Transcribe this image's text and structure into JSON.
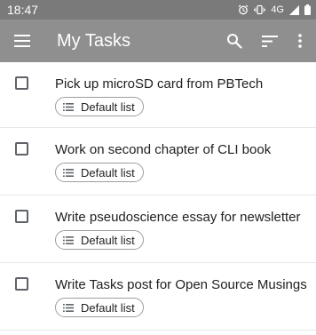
{
  "status_bar": {
    "time": "18:47",
    "network": "4G",
    "icons": [
      "alarm-icon",
      "vibrate-icon",
      "signal-icon",
      "battery-icon"
    ]
  },
  "app_bar": {
    "title": "My Tasks",
    "icons": [
      "menu-icon",
      "search-icon",
      "sort-icon",
      "more-vert-icon"
    ]
  },
  "tasks": [
    {
      "title": "Pick up microSD card from PBTech",
      "list": "Default list",
      "completed": false
    },
    {
      "title": "Work on second chapter of CLI  book",
      "list": "Default list",
      "completed": false
    },
    {
      "title": "Write pseudoscience essay for newsletter",
      "list": "Default list",
      "completed": false
    },
    {
      "title": "Write Tasks post for Open Source Musings",
      "list": "Default list",
      "completed": false
    }
  ],
  "colors": {
    "status_bar_bg": "#7a7a7a",
    "app_bar_bg": "#8f8f8f",
    "text": "#202124"
  }
}
